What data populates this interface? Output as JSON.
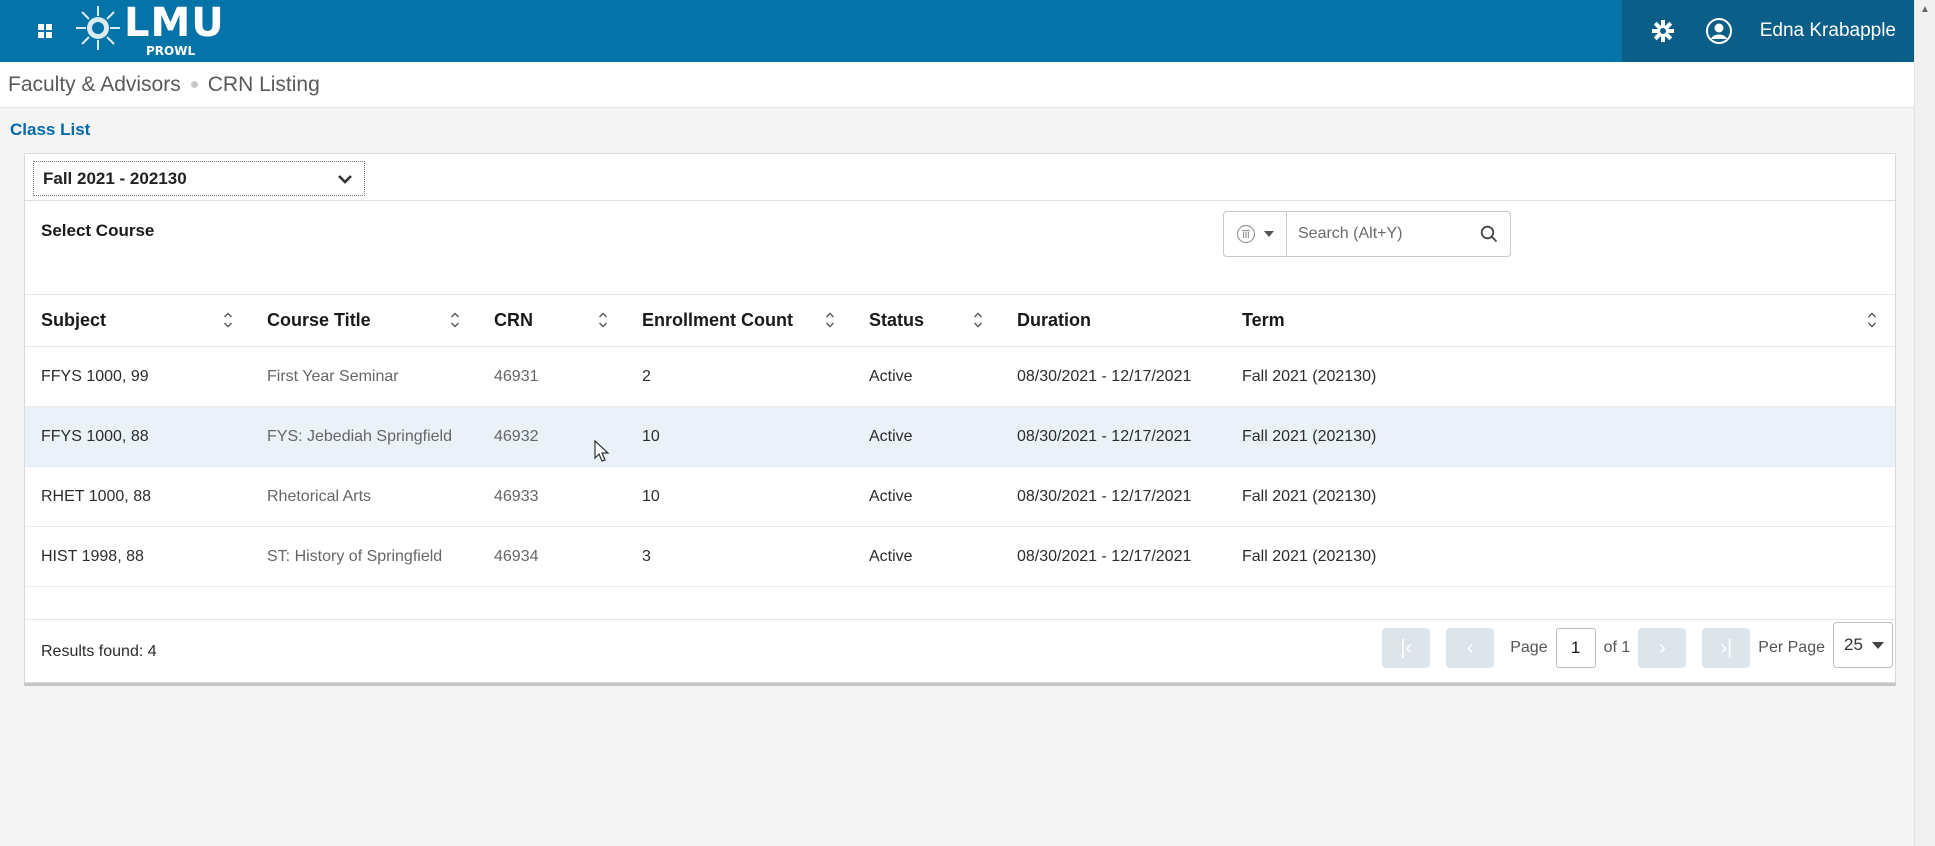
{
  "header": {
    "logo_text": "LMU",
    "logo_sub": "PROWL",
    "user_name": "Edna Krabapple",
    "icons": [
      "grid-icon",
      "gear-icon",
      "user-icon"
    ],
    "color": "#0373a8"
  },
  "breadcrumb": {
    "items": [
      "Faculty & Advisors",
      "CRN Listing"
    ]
  },
  "page": {
    "title": "Class List"
  },
  "term_select": {
    "value": "Fall 2021 - 202130"
  },
  "course_section": {
    "title": "Select Course",
    "search_placeholder": "Search (Alt+Y)"
  },
  "table": {
    "columns": [
      "Subject",
      "Course Title",
      "CRN",
      "Enrollment Count",
      "Status",
      "Duration",
      "Term"
    ],
    "rows": [
      [
        "FFYS 1000, 99",
        "First Year Seminar",
        "46931",
        "2",
        "Active",
        "08/30/2021 - 12/17/2021",
        "Fall 2021 (202130)"
      ],
      [
        "FFYS 1000, 88",
        "FYS: Jebediah Springfield",
        "46932",
        "10",
        "Active",
        "08/30/2021 - 12/17/2021",
        "Fall 2021 (202130)"
      ],
      [
        "RHET 1000, 88",
        "Rhetorical Arts",
        "46933",
        "10",
        "Active",
        "08/30/2021 - 12/17/2021",
        "Fall 2021 (202130)"
      ],
      [
        "HIST 1998, 88",
        "ST: History of Springfield",
        "46934",
        "3",
        "Active",
        "08/30/2021 - 12/17/2021",
        "Fall 2021 (202130)"
      ]
    ],
    "highlight_color": "#eaf1f8"
  },
  "footer": {
    "results_text": "Results found: 4",
    "page_label": "Page",
    "page_value": "1",
    "of_label": "of 1",
    "per_page_label": "Per Page",
    "per_page_value": "25"
  }
}
